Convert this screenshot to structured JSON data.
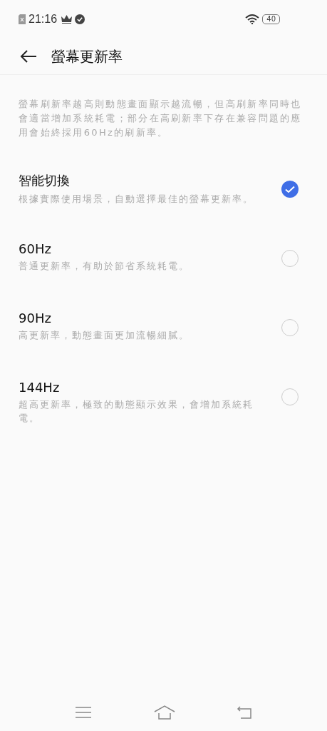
{
  "status_bar": {
    "time": "21:16",
    "battery": "40"
  },
  "header": {
    "title": "螢幕更新率"
  },
  "description": "螢幕刷新率越高則動態畫面顯示越流暢，但高刷新率同時也會適當增加系統耗電；部分在高刷新率下存在兼容問題的應用會始終採用60Hz的刷新率。",
  "options": [
    {
      "title": "智能切換",
      "subtitle": "根據實際使用場景，自動選擇最佳的螢幕更新率。",
      "selected": true
    },
    {
      "title": "60Hz",
      "subtitle": "普通更新率，有助於節省系統耗電。",
      "selected": false
    },
    {
      "title": "90Hz",
      "subtitle": "高更新率，動態畫面更加流暢細膩。",
      "selected": false
    },
    {
      "title": "144Hz",
      "subtitle": "超高更新率，極致的動態顯示效果，會增加系統耗電。",
      "selected": false
    }
  ]
}
